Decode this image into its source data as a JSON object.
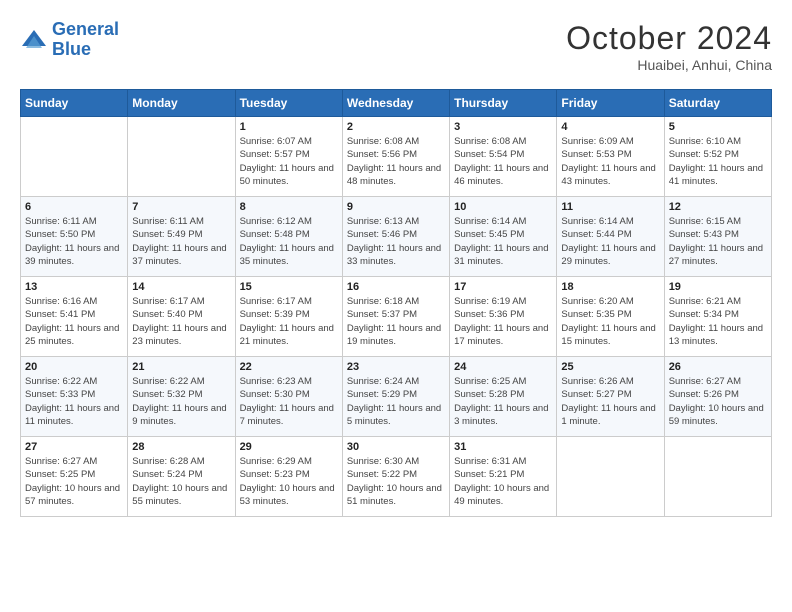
{
  "logo": {
    "line1": "General",
    "line2": "Blue"
  },
  "title": "October 2024",
  "location": "Huaibei, Anhui, China",
  "weekdays": [
    "Sunday",
    "Monday",
    "Tuesday",
    "Wednesday",
    "Thursday",
    "Friday",
    "Saturday"
  ],
  "weeks": [
    [
      {
        "num": "",
        "info": ""
      },
      {
        "num": "",
        "info": ""
      },
      {
        "num": "1",
        "info": "Sunrise: 6:07 AM\nSunset: 5:57 PM\nDaylight: 11 hours and 50 minutes."
      },
      {
        "num": "2",
        "info": "Sunrise: 6:08 AM\nSunset: 5:56 PM\nDaylight: 11 hours and 48 minutes."
      },
      {
        "num": "3",
        "info": "Sunrise: 6:08 AM\nSunset: 5:54 PM\nDaylight: 11 hours and 46 minutes."
      },
      {
        "num": "4",
        "info": "Sunrise: 6:09 AM\nSunset: 5:53 PM\nDaylight: 11 hours and 43 minutes."
      },
      {
        "num": "5",
        "info": "Sunrise: 6:10 AM\nSunset: 5:52 PM\nDaylight: 11 hours and 41 minutes."
      }
    ],
    [
      {
        "num": "6",
        "info": "Sunrise: 6:11 AM\nSunset: 5:50 PM\nDaylight: 11 hours and 39 minutes."
      },
      {
        "num": "7",
        "info": "Sunrise: 6:11 AM\nSunset: 5:49 PM\nDaylight: 11 hours and 37 minutes."
      },
      {
        "num": "8",
        "info": "Sunrise: 6:12 AM\nSunset: 5:48 PM\nDaylight: 11 hours and 35 minutes."
      },
      {
        "num": "9",
        "info": "Sunrise: 6:13 AM\nSunset: 5:46 PM\nDaylight: 11 hours and 33 minutes."
      },
      {
        "num": "10",
        "info": "Sunrise: 6:14 AM\nSunset: 5:45 PM\nDaylight: 11 hours and 31 minutes."
      },
      {
        "num": "11",
        "info": "Sunrise: 6:14 AM\nSunset: 5:44 PM\nDaylight: 11 hours and 29 minutes."
      },
      {
        "num": "12",
        "info": "Sunrise: 6:15 AM\nSunset: 5:43 PM\nDaylight: 11 hours and 27 minutes."
      }
    ],
    [
      {
        "num": "13",
        "info": "Sunrise: 6:16 AM\nSunset: 5:41 PM\nDaylight: 11 hours and 25 minutes."
      },
      {
        "num": "14",
        "info": "Sunrise: 6:17 AM\nSunset: 5:40 PM\nDaylight: 11 hours and 23 minutes."
      },
      {
        "num": "15",
        "info": "Sunrise: 6:17 AM\nSunset: 5:39 PM\nDaylight: 11 hours and 21 minutes."
      },
      {
        "num": "16",
        "info": "Sunrise: 6:18 AM\nSunset: 5:37 PM\nDaylight: 11 hours and 19 minutes."
      },
      {
        "num": "17",
        "info": "Sunrise: 6:19 AM\nSunset: 5:36 PM\nDaylight: 11 hours and 17 minutes."
      },
      {
        "num": "18",
        "info": "Sunrise: 6:20 AM\nSunset: 5:35 PM\nDaylight: 11 hours and 15 minutes."
      },
      {
        "num": "19",
        "info": "Sunrise: 6:21 AM\nSunset: 5:34 PM\nDaylight: 11 hours and 13 minutes."
      }
    ],
    [
      {
        "num": "20",
        "info": "Sunrise: 6:22 AM\nSunset: 5:33 PM\nDaylight: 11 hours and 11 minutes."
      },
      {
        "num": "21",
        "info": "Sunrise: 6:22 AM\nSunset: 5:32 PM\nDaylight: 11 hours and 9 minutes."
      },
      {
        "num": "22",
        "info": "Sunrise: 6:23 AM\nSunset: 5:30 PM\nDaylight: 11 hours and 7 minutes."
      },
      {
        "num": "23",
        "info": "Sunrise: 6:24 AM\nSunset: 5:29 PM\nDaylight: 11 hours and 5 minutes."
      },
      {
        "num": "24",
        "info": "Sunrise: 6:25 AM\nSunset: 5:28 PM\nDaylight: 11 hours and 3 minutes."
      },
      {
        "num": "25",
        "info": "Sunrise: 6:26 AM\nSunset: 5:27 PM\nDaylight: 11 hours and 1 minute."
      },
      {
        "num": "26",
        "info": "Sunrise: 6:27 AM\nSunset: 5:26 PM\nDaylight: 10 hours and 59 minutes."
      }
    ],
    [
      {
        "num": "27",
        "info": "Sunrise: 6:27 AM\nSunset: 5:25 PM\nDaylight: 10 hours and 57 minutes."
      },
      {
        "num": "28",
        "info": "Sunrise: 6:28 AM\nSunset: 5:24 PM\nDaylight: 10 hours and 55 minutes."
      },
      {
        "num": "29",
        "info": "Sunrise: 6:29 AM\nSunset: 5:23 PM\nDaylight: 10 hours and 53 minutes."
      },
      {
        "num": "30",
        "info": "Sunrise: 6:30 AM\nSunset: 5:22 PM\nDaylight: 10 hours and 51 minutes."
      },
      {
        "num": "31",
        "info": "Sunrise: 6:31 AM\nSunset: 5:21 PM\nDaylight: 10 hours and 49 minutes."
      },
      {
        "num": "",
        "info": ""
      },
      {
        "num": "",
        "info": ""
      }
    ]
  ]
}
